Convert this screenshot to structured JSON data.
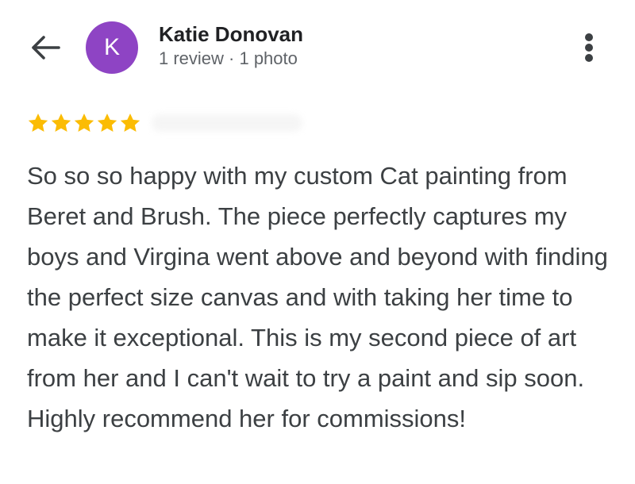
{
  "header": {
    "back_icon": "arrow-left-icon",
    "avatar_initial": "K",
    "avatar_color": "#8e44c4",
    "reviewer_name": "Katie Donovan",
    "reviewer_meta": "1 review · 1 photo",
    "more_icon": "more-vert-icon"
  },
  "review": {
    "rating": 5,
    "max_rating": 5,
    "star_color": "#fbbc04",
    "text": "So so so happy with my custom Cat painting from Beret and Brush. The piece perfectly captures my boys and Virgina went above and beyond with finding the perfect size canvas and with taking her time to make it exceptional. This is my second piece of art from her and I can't wait to try a paint and sip soon. Highly recommend her for commissions!"
  }
}
